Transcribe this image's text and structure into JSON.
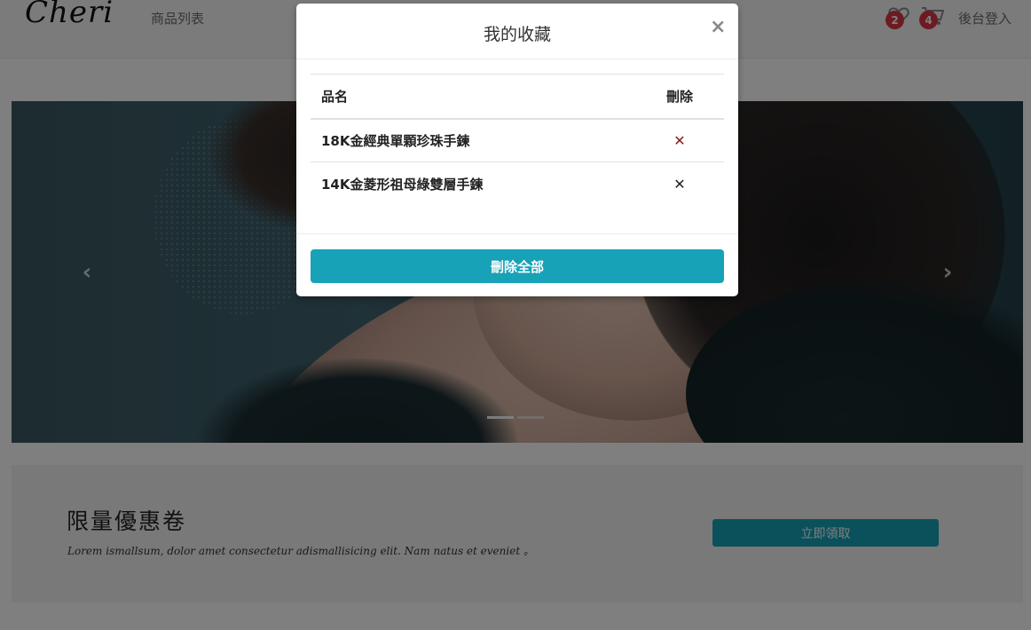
{
  "navbar": {
    "brand": "Cheri",
    "product_list": "商品列表",
    "favorites_count": "2",
    "cart_count": "4",
    "login": "後台登入"
  },
  "carousel": {
    "prev_glyph": "‹",
    "next_glyph": "›",
    "indicator_count": 2,
    "active_index": 0
  },
  "coupon": {
    "title": "限量優惠卷",
    "description": "Lorem ismallsum, dolor amet consectetur adismallisicing elit. Nam natus et eveniet 。",
    "button": "立即領取"
  },
  "modal": {
    "title": "我的收藏",
    "close": "×",
    "headers": {
      "name": "品名",
      "delete": "刪除"
    },
    "items": [
      {
        "name": "18K金經典單顆珍珠手鍊",
        "delete": "✕",
        "color": "#8b1a1a"
      },
      {
        "name": "14K金菱形祖母綠雙層手鍊",
        "delete": "✕",
        "color": "#222222"
      }
    ],
    "delete_all": "刪除全部"
  },
  "colors": {
    "accent": "#17a2b8",
    "badge": "#dc3545"
  }
}
